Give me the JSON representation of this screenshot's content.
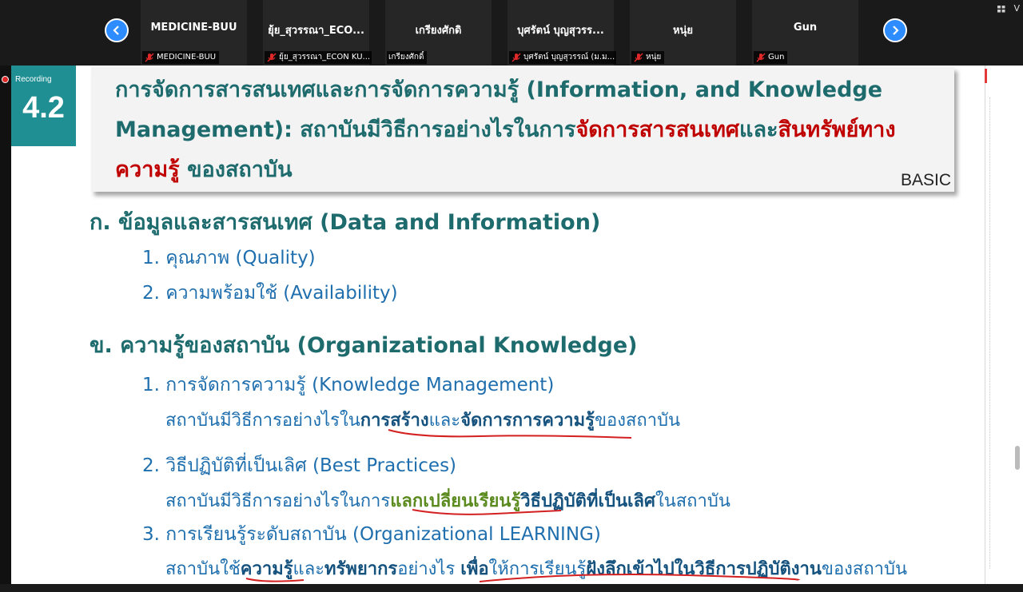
{
  "participants": [
    {
      "name": "MEDICINE-BUU",
      "tag": "MEDICINE-BUU"
    },
    {
      "name": "ยุ้ย_สุวรรณา_ECO...",
      "tag": "ยุ้ย_สุวรรณา_ECON KU..."
    },
    {
      "name": "เกรียงศักดิ",
      "tag": "เกรียงศักดิ์"
    },
    {
      "name": "บุศรัตน์ บุญสุวรร...",
      "tag": "บุศรัตน์ บุญสุวรรณ์ (ม.ม..."
    },
    {
      "name": "หนุ่ย",
      "tag": "หนุ่ย"
    },
    {
      "name": "Gun",
      "tag": "Gun"
    }
  ],
  "view_label": "V",
  "recording_label": "Recording",
  "slide": {
    "number": "4.2",
    "title_part1": "การจัดการสารสนเทศและการจัดการความรู้ (Information, and Knowledge Management): สถาบันมีวิธีการอย่างไรในการ",
    "title_red1": "จัดการสารสนเทศ",
    "title_and": "และ",
    "title_red2": "สินทรัพย์ทางความรู้",
    "title_end": " ของสถาบัน",
    "level": "BASIC",
    "section_a": "ก. ข้อมูลและสารสนเทศ (Data and Information)",
    "a1": "1. คุณภาพ (Quality)",
    "a2": "2. ความพร้อมใช้ (Availability)",
    "section_b": "ข. ความรู้ของสถาบัน (Organizational Knowledge)",
    "b1": "1. การจัดการความรู้ (Knowledge Management)",
    "b1_pre": "สถาบันมีวิธีการอย่างไรใน",
    "b1_bold1": "การสร้าง",
    "b1_mid": "และ",
    "b1_bold2": "จัดการการความรู้",
    "b1_post": "ของสถาบัน",
    "b2": "2. วิธีปฏิบัติที่เป็นเลิศ (Best Practices)",
    "b2_pre": "สถาบันมีวิธีการอย่างไรในการ",
    "b2_green": "แลกเปลี่ยนเรียนรู้",
    "b2_bold": "วิธีปฏิบัติที่เป็นเลิศ",
    "b2_post": "ในสถาบัน",
    "b3": "3. การเรียนรู้ระดับสถาบัน (Organizational LEARNING)",
    "b3_pre": "สถาบันใช้",
    "b3_bold1": "ความรู้",
    "b3_mid1": "และ",
    "b3_bold2": "ทรัพยากร",
    "b3_mid2": "อย่างไร ",
    "b3_bold3": "เพื่อ",
    "b3_mid3": "ให้การเรียนรู้",
    "b3_bold4": "ฝังลึกเข้าไปในวิธีการปฏิบัติงาน",
    "b3_post": "ของสถาบัน"
  },
  "colors": {
    "accent": "#2d8cff",
    "teal": "#1f8f93",
    "heading": "#1e6b6e",
    "body": "#1f6fae",
    "red": "#c00000",
    "ink": "#d42020"
  }
}
